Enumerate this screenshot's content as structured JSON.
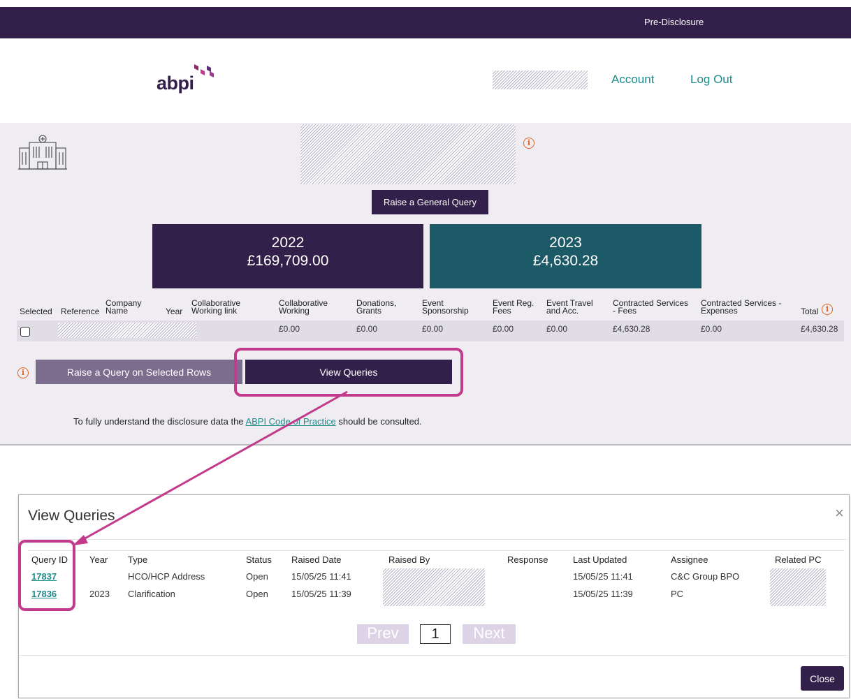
{
  "header": {
    "pre_disclosure": "Pre-Disclosure",
    "logo_text": "abpi",
    "nav": {
      "account": "Account",
      "logout": "Log Out"
    }
  },
  "main": {
    "info_glyph": "i",
    "raise_general_query": "Raise a General Query",
    "years": [
      {
        "year": "2022",
        "amount": "£169,709.00",
        "color": "#33204a"
      },
      {
        "year": "2023",
        "amount": "£4,630.28",
        "color": "#1d5a67"
      }
    ],
    "table": {
      "headers": {
        "selected": "Selected",
        "reference": "Reference",
        "company_name": [
          "Company",
          "Name"
        ],
        "year": "Year",
        "collab_link": [
          "Collaborative",
          "Working link"
        ],
        "collab_working": [
          "Collaborative",
          "Working"
        ],
        "donations": [
          "Donations,",
          "Grants"
        ],
        "event_sponsorship": [
          "Event",
          "Sponsorship"
        ],
        "event_reg": [
          "Event Reg.",
          "Fees"
        ],
        "event_travel": [
          "Event Travel",
          "and Acc."
        ],
        "cs_fees": [
          "Contracted Services",
          "- Fees"
        ],
        "cs_expenses": [
          "Contracted Services -",
          "Expenses"
        ],
        "total": "Total"
      },
      "row": {
        "collab_working": "£0.00",
        "donations": "£0.00",
        "event_sponsorship": "£0.00",
        "event_reg": "£0.00",
        "event_travel": "£0.00",
        "cs_fees": "£4,630.28",
        "cs_expenses": "£0.00",
        "total": "£4,630.28"
      }
    },
    "raise_selected": "Raise a Query on Selected Rows",
    "view_queries": "View Queries",
    "footer_note_pre": "To fully understand the disclosure data the ",
    "footer_note_link": "ABPI Code of Practice",
    "footer_note_post": " should be consulted."
  },
  "modal": {
    "title": "View Queries",
    "close_x": "×",
    "columns": [
      "Query ID",
      "Year",
      "Type",
      "Status",
      "Raised Date",
      "Raised By",
      "Response",
      "Last Updated",
      "Assignee",
      "Related PC"
    ],
    "rows": [
      {
        "id": "17837",
        "year": "",
        "type": "HCO/HCP Address",
        "status": "Open",
        "raised": "15/05/25 11:41",
        "updated": "15/05/25 11:41",
        "assignee": "C&C Group BPO"
      },
      {
        "id": "17836",
        "year": "2023",
        "type": "Clarification",
        "status": "Open",
        "raised": "15/05/25 11:39",
        "updated": "15/05/25 11:39",
        "assignee": "PC"
      }
    ],
    "pager": {
      "prev": "Prev",
      "page": "1",
      "next": "Next"
    },
    "close_button": "Close"
  },
  "colors": {
    "brand_purple": "#33204a",
    "teal": "#1d5a67",
    "link": "#1e8a8a",
    "highlight": "#c23a8c",
    "info_orange": "#e06320"
  }
}
